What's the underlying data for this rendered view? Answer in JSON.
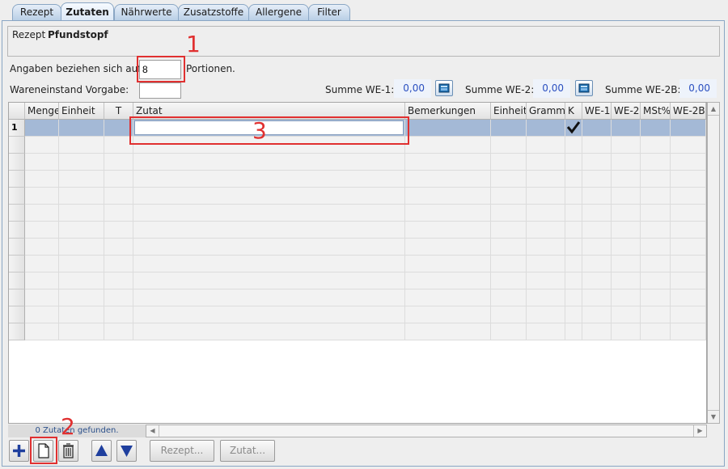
{
  "tabs": [
    {
      "label": "Rezept",
      "active": false
    },
    {
      "label": "Zutaten",
      "active": true
    },
    {
      "label": "Nährwerte",
      "active": false
    },
    {
      "label": "Zusatzstoffe",
      "active": false
    },
    {
      "label": "Allergene",
      "active": false
    },
    {
      "label": "Filter",
      "active": false
    }
  ],
  "recipe": {
    "label": "Rezept",
    "name": "Pfundstopf"
  },
  "portions": {
    "prefix": "Angaben beziehen sich auf",
    "value": "8",
    "suffix": "Portionen."
  },
  "stock": {
    "label": "Wareneinstand Vorgabe:",
    "value": ""
  },
  "sums": [
    {
      "label": "Summe WE-1:",
      "value": "0,00"
    },
    {
      "label": "Summe WE-2:",
      "value": "0,00"
    },
    {
      "label": "Summe WE-2B:",
      "value": "0,00"
    }
  ],
  "table": {
    "columns": [
      "Menge",
      "Einheit",
      "T",
      "Zutat",
      "Bemerkungen",
      "Einheit",
      "Gramm",
      "K",
      "WE-1",
      "WE-2",
      "MSt%",
      "WE-2B"
    ],
    "rows": [
      {
        "index": "1",
        "checked": true
      }
    ]
  },
  "status": {
    "found_text": "0 Zutaten gefunden."
  },
  "toolbar": {
    "recipe_button": "Rezept...",
    "ingredient_button": "Zutat..."
  },
  "annotations": [
    "1",
    "2",
    "3"
  ],
  "colors": {
    "annotation": "#e03030",
    "selected_row": "#a4b9d6",
    "sum_text": "#2a4fc0"
  }
}
